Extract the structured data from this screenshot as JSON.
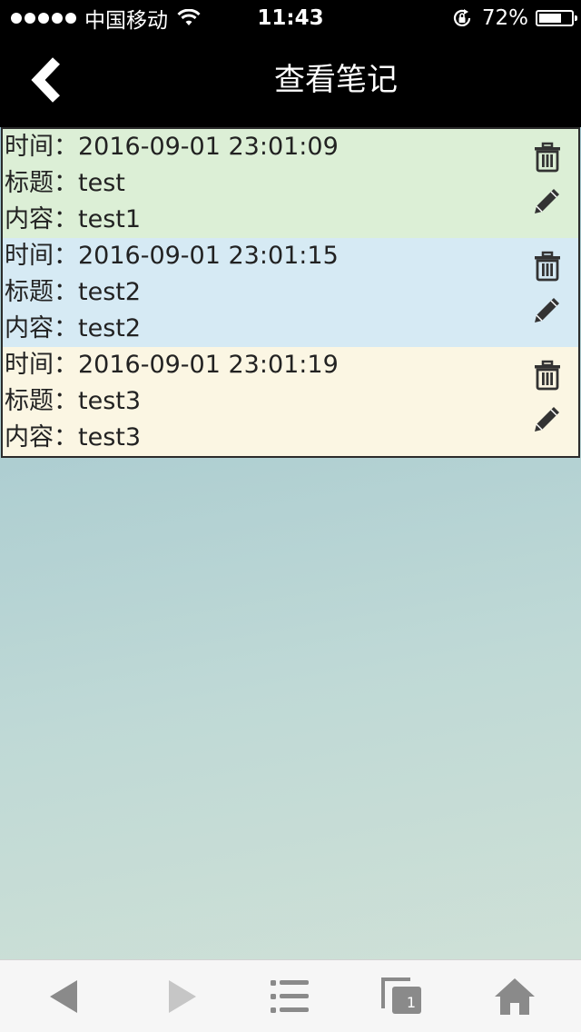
{
  "status_bar": {
    "carrier": "中国移动",
    "time": "11:43",
    "battery_percent": "72%",
    "battery_level": 0.72,
    "signal_dots": 5
  },
  "nav": {
    "title": "查看笔记",
    "back_icon": "chevron-left-icon"
  },
  "labels": {
    "time": "时间：",
    "title": "标题：",
    "content": "内容："
  },
  "notes": [
    {
      "time": "2016-09-01 23:01:09",
      "title": "test",
      "content": "test1",
      "bg": "#dcefd6"
    },
    {
      "time": "2016-09-01 23:01:15",
      "title": "test2",
      "content": "test2",
      "bg": "#d6eaf4"
    },
    {
      "time": "2016-09-01 23:01:19",
      "title": "test3",
      "content": "test3",
      "bg": "#fbf6e3"
    }
  ],
  "note_icons": {
    "delete": "trash-icon",
    "edit": "pencil-icon"
  },
  "toolbar": {
    "tabs_count": "1",
    "icons": [
      "back-arrow-icon",
      "forward-arrow-icon",
      "list-icon",
      "tabs-icon",
      "home-icon"
    ]
  },
  "colors": {
    "header_bg": "#000000",
    "toolbar_icon": "#8a8a8a",
    "toolbar_icon_disabled": "#c6c6c6"
  }
}
